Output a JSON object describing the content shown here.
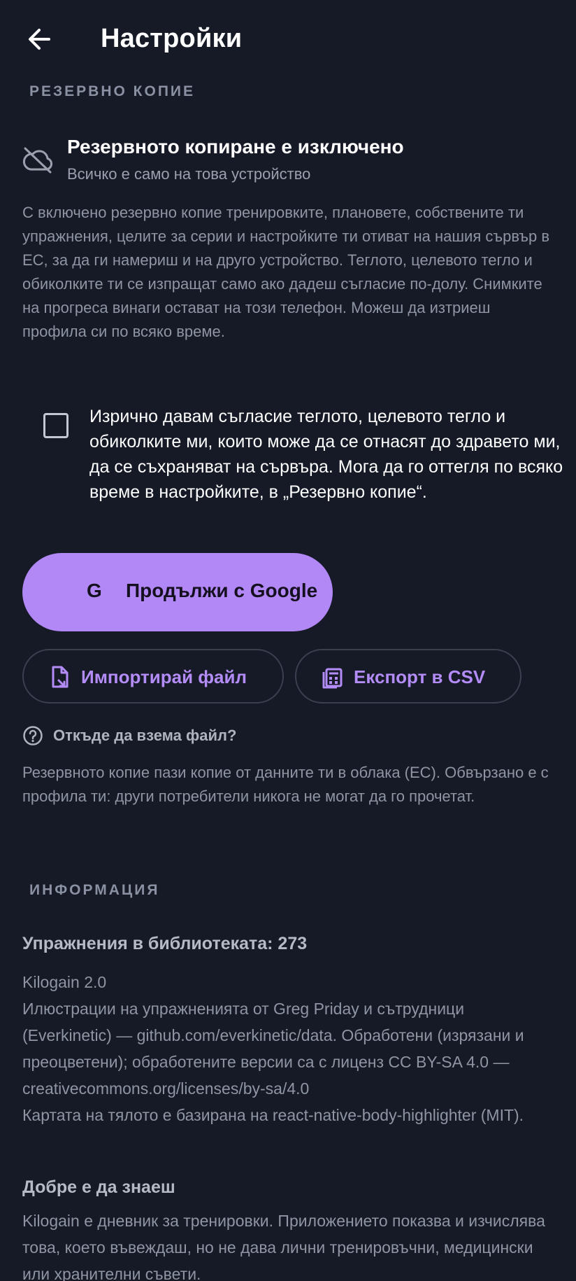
{
  "header": {
    "title": "Настройки"
  },
  "backup": {
    "section_title": "РЕЗЕРВНО КОПИЕ",
    "status_title": "Резервното копиране е изключено",
    "status_subtitle": "Всичко е само на това устройство",
    "description": "С включено резервно копие тренировките, плановете, собствените ти упражнения, целите за серии и настройките ти отиват на нашия сървър в ЕС, за да ги намериш и на друго устройство. Теглото, целевото тегло и обиколките ти се изпращат само ако дадеш съгласие по-долу. Снимките на прогреса винаги остават на този телефон. Можеш да изтриеш профила си по всяко време.",
    "consent_checked": false,
    "consent_text": "Изрично давам съгласие теглото, целевото тегло и обиколките ми, които може да се отнасят до здравето ми, да се съхраняват на сървъра. Мога да го оттегля по всяко време в настройките, в „Резервно копие“.",
    "google_button_icon": "G",
    "google_button_label": "Продължи с Google",
    "import_label": "Импортирай файл",
    "export_label": "Експорт в CSV",
    "help_label": "Откъде да взема файл?",
    "footnote": "Резервното копие пази копие от данните ти в облака (ЕС). Обвързано е с профила ти: други потребители никога не могат да го прочетат."
  },
  "info": {
    "section_title": "ИНФОРМАЦИЯ",
    "library_count": "Упражнения в библиотеката: 273",
    "version": "Kilogain 2.0",
    "credits": "Илюстрации на упражненията от Greg Priday и сътрудници (Everkinetic) — github.com/everkinetic/data. Обработени (изрязани и преоцветени); обработените версии са с лиценз CC BY-SA 4.0 — creativecommons.org/licenses/by-sa/4.0",
    "body_map": "Картата на тялото е базирана на react-native-body-highlighter (MIT).",
    "good_to_know_title": "Добре е да знаеш",
    "good_to_know_text": "Kilogain е дневник за тренировки. Приложението показва и изчислява това, което въвеждаш, но не дава лични тренировъчни, медицински или хранителни съвети."
  },
  "colors": {
    "background": "#151a26",
    "accent": "#b288f7",
    "accent_text": "#b48cf7",
    "muted_text": "#8e95a3"
  },
  "icons": {
    "back": "arrow-left-icon",
    "status": "cloud-off-icon",
    "import": "file-import-icon",
    "export": "calculator-icon",
    "help": "help-circle-icon"
  }
}
